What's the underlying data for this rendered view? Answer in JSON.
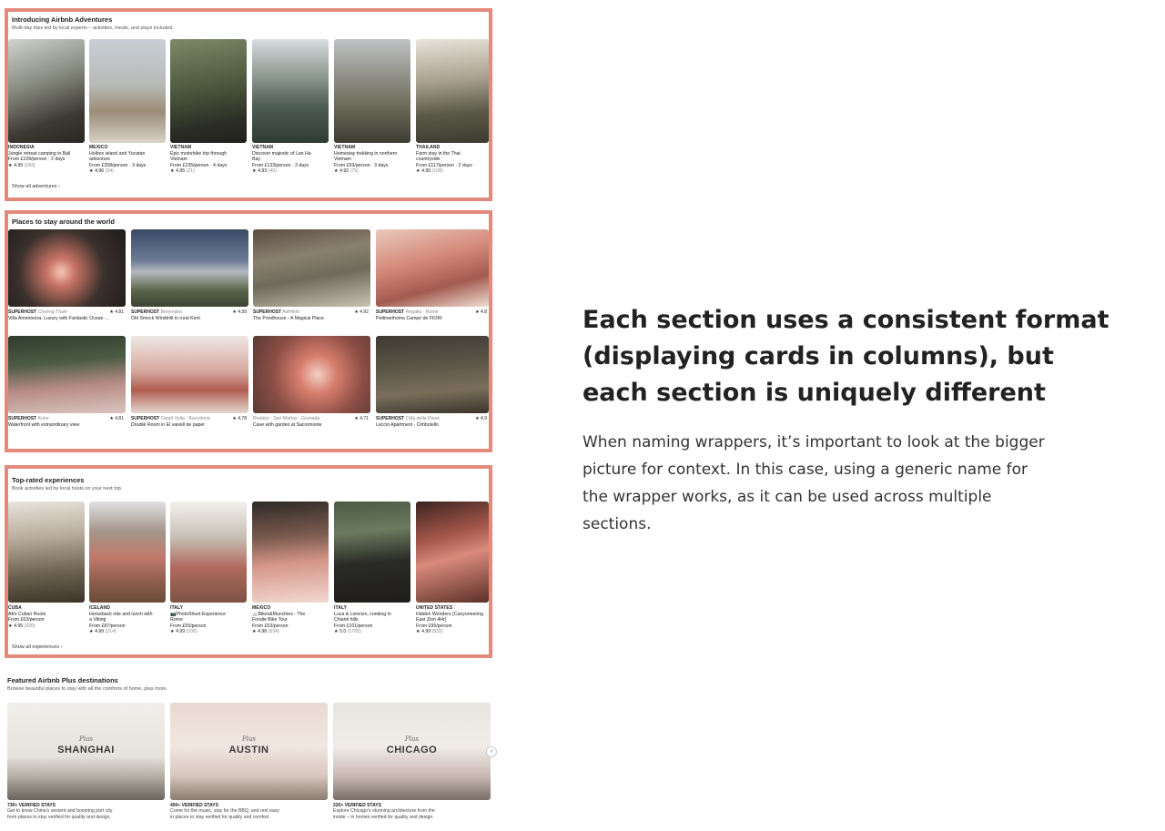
{
  "adventures": {
    "title": "Introducing Airbnb Adventures",
    "subtitle": "Multi-day trips led by local experts – activities, meals, and stays included.",
    "link": "Show all adventures ›",
    "cards": [
      {
        "country": "INDONESIA",
        "line1": "Jungle retreat camping in Bali",
        "line2": "",
        "price": "From £109/person · 2 days",
        "rating": "★ 4.99",
        "count": "(183)"
      },
      {
        "country": "MEXICO",
        "line1": "Holbox island and Yucatan",
        "line2": "adventure",
        "price": "From £358/person · 3 days",
        "rating": "★ 4.96",
        "count": "(24)"
      },
      {
        "country": "VIETNAM",
        "line1": "Epic motorbike trip through",
        "line2": "Vietnam",
        "price": "From £235/person · 4 days",
        "rating": "★ 4.95",
        "count": "(21)"
      },
      {
        "country": "VIETNAM",
        "line1": "Discover majestic of Lan Ha",
        "line2": "Bay",
        "price": "From £133/person · 3 days",
        "rating": "★ 4.93",
        "count": "(40)"
      },
      {
        "country": "VIETNAM",
        "line1": "Homestay trekking in northern",
        "line2": "Vietnam",
        "price": "From £93/person · 3 days",
        "rating": "★ 4.92",
        "count": "(75)"
      },
      {
        "country": "THAILAND",
        "line1": "Farm stay in the Thai",
        "line2": "countryside",
        "price": "From £117/person · 2 days",
        "rating": "★ 4.95",
        "count": "(108)"
      }
    ]
  },
  "places": {
    "title": "Places to stay around the world",
    "cards": [
      {
        "badge": "SUPERHOST",
        "place": "Choeng Thale",
        "rating": "★ 4.81",
        "name": "Villa Amonteera, Luxury with Fantastic Ocean …"
      },
      {
        "badge": "SUPERHOST",
        "place": "Benenden",
        "rating": "★ 4.99",
        "name": "Old Smock Windmill in rural Kent"
      },
      {
        "badge": "SUPERHOST",
        "place": "Ashfield",
        "rating": "★ 4.92",
        "name": "The Pondhouse - A Magical Place"
      },
      {
        "badge": "SUPERHOST",
        "place": "Regalia · Rome",
        "rating": "★ 4.8",
        "name": "Pettinarihome Campo de FIORI"
      },
      {
        "badge": "SUPERHOST",
        "place": "Kotor",
        "rating": "★ 4.81",
        "name": "Waterfront with extraordinary view"
      },
      {
        "badge": "SUPERHOST",
        "place": "Ostalt Vella · Barcelona",
        "rating": "★ 4.78",
        "name": "Double Room in El vaixell de paper"
      },
      {
        "badge": "",
        "place": "Realejo - San Matías · Granada",
        "rating": "★ 4.71",
        "name": "Cave with garden at Sacromonte"
      },
      {
        "badge": "SUPERHOST",
        "place": "Città della Pieve",
        "rating": "★ 4.9",
        "name": "Leccio Apartment - Cimbolello"
      }
    ]
  },
  "experiences": {
    "title": "Top-rated experiences",
    "subtitle": "Book activities led by local hosts on your next trip.",
    "link": "Show all experiences ›",
    "cards": [
      {
        "country": "CUBA",
        "line1": "Afro Cuban Roots",
        "line2": "",
        "price": "From £63/person",
        "rating": "★ 4.95",
        "count": "(320)"
      },
      {
        "country": "ICELAND",
        "line1": "Horseback ride and lunch with",
        "line2": "a Viking",
        "price": "From £87/person",
        "rating": "★ 4.99",
        "count": "(214)"
      },
      {
        "country": "ITALY",
        "line1": "📷PhotoShoot Experience",
        "line2": "Rome",
        "price": "From £55/person",
        "rating": "★ 4.99",
        "count": "(106)"
      },
      {
        "country": "MEXICO",
        "line1": "🚲Bikes&Munchies - The",
        "line2": "Foodie Bike Tour",
        "price": "From £53/person",
        "rating": "★ 4.98",
        "count": "(534)"
      },
      {
        "country": "ITALY",
        "line1": "Luca & Lorenzo, cooking in",
        "line2": "Chianti hills",
        "price": "From £101/person",
        "rating": "★ 5.0",
        "count": "(1765)"
      },
      {
        "country": "UNITED STATES",
        "line1": "Hidden Wonders (Canyoneering",
        "line2": "East Zion 4Hr)",
        "price": "From £95/person",
        "rating": "★ 4.99",
        "count": "(532)"
      }
    ]
  },
  "plus": {
    "title": "Featured Airbnb Plus destinations",
    "subtitle": "Browse beautiful places to stay with all the comforts of home, plus more.",
    "script_label": "Plus",
    "cards": [
      {
        "city": "SHANGHAI",
        "count": "730+ VERIFIED STAYS",
        "line1": "Get to know China's ancient and booming port city",
        "line2": "from places to stay verified for quality and design."
      },
      {
        "city": "AUSTIN",
        "count": "400+ VERIFIED STAYS",
        "line1": "Come for the music, stay for the BBQ, and rest easy",
        "line2": "in places to stay verified for quality and comfort."
      },
      {
        "city": "CHICAGO",
        "count": "220+ VERIFIED STAYS",
        "line1": "Explore Chicago's stunning architecture from the",
        "line2": "inside – in homes verified for quality and design."
      }
    ]
  },
  "explanation": {
    "heading_l1": "Each section uses a consistent format",
    "heading_l2": "(displaying cards in columns), but",
    "heading_l3": "each section is uniquely different",
    "para_l1": "When naming wrappers, it’s important to look at the bigger",
    "para_l2": "picture for context. In this case, using a generic name for",
    "para_l3": "the wrapper works, as it can be used across multiple",
    "para_l4": "sections."
  },
  "colors": {
    "highlight": "#e38a7c"
  },
  "icons": {
    "next": "chevron-right-icon",
    "star": "star-icon"
  }
}
